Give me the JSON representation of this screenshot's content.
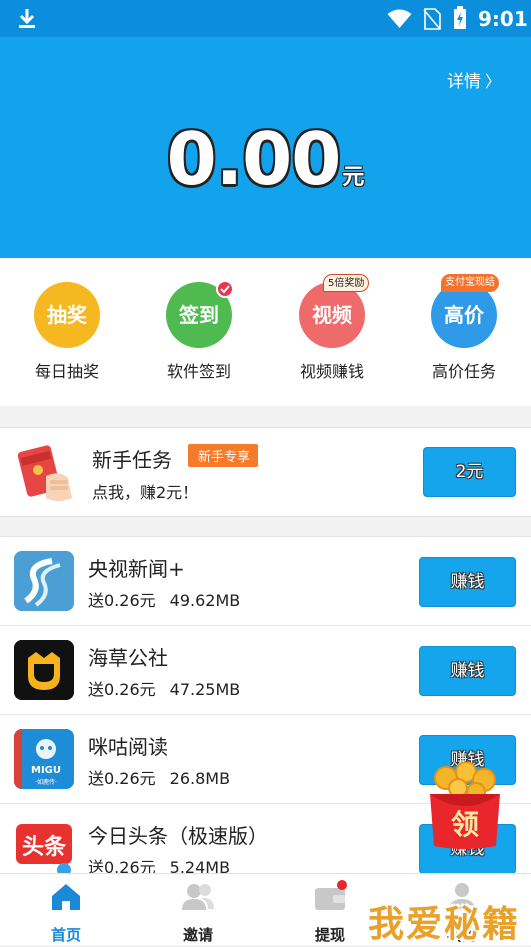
{
  "status_bar": {
    "time": "9:01"
  },
  "header": {
    "detail_label": "详情",
    "balance": "0.00",
    "unit": "元"
  },
  "quick_actions": [
    {
      "icon_text": "抽奖",
      "label": "每日抽奖",
      "color": "#f6b820",
      "badge": ""
    },
    {
      "icon_text": "签到",
      "label": "软件签到",
      "color": "#4fba4f",
      "badge": ""
    },
    {
      "icon_text": "视频",
      "label": "视频赚钱",
      "color": "#ef6a6a",
      "badge": "5倍奖励"
    },
    {
      "icon_text": "高价",
      "label": "高价任务",
      "color": "#2f9ae8",
      "badge": "支付宝现结"
    }
  ],
  "newbie_task": {
    "title": "新手任务",
    "tag": "新手专享",
    "subtitle": "点我，赚2元！",
    "button": "2元"
  },
  "apps": [
    {
      "name": "央视新闻+",
      "reward": "送0.26元",
      "size": "49.62MB",
      "button": "赚钱",
      "icon": "cctv-news-icon"
    },
    {
      "name": "海草公社",
      "reward": "送0.26元",
      "size": "47.25MB",
      "button": "赚钱",
      "icon": "haicao-icon"
    },
    {
      "name": "咪咕阅读",
      "reward": "送0.26元",
      "size": "26.8MB",
      "button": "赚钱",
      "icon": "migu-icon",
      "icon_text": "MIGU",
      "icon_sub": "·如鹿传·"
    },
    {
      "name": "今日头条（极速版）",
      "reward": "送0.26元",
      "size": "5.24MB",
      "button": "赚钱",
      "icon": "toutiao-icon",
      "icon_text": "头条"
    }
  ],
  "floating_envelope": {
    "label": "领"
  },
  "bottom_nav": [
    {
      "label": "首页",
      "icon": "home-icon",
      "active": true
    },
    {
      "label": "邀请",
      "icon": "invite-icon",
      "active": false
    },
    {
      "label": "提现",
      "icon": "wallet-icon",
      "active": false
    },
    {
      "label": "我的",
      "icon": "profile-icon",
      "active": false
    }
  ],
  "watermark": "我爱秘籍",
  "colors": {
    "primary": "#12a3ec",
    "status_bar": "#0b8fdc",
    "button": "#14a5ec",
    "tag": "#f57a2a"
  }
}
